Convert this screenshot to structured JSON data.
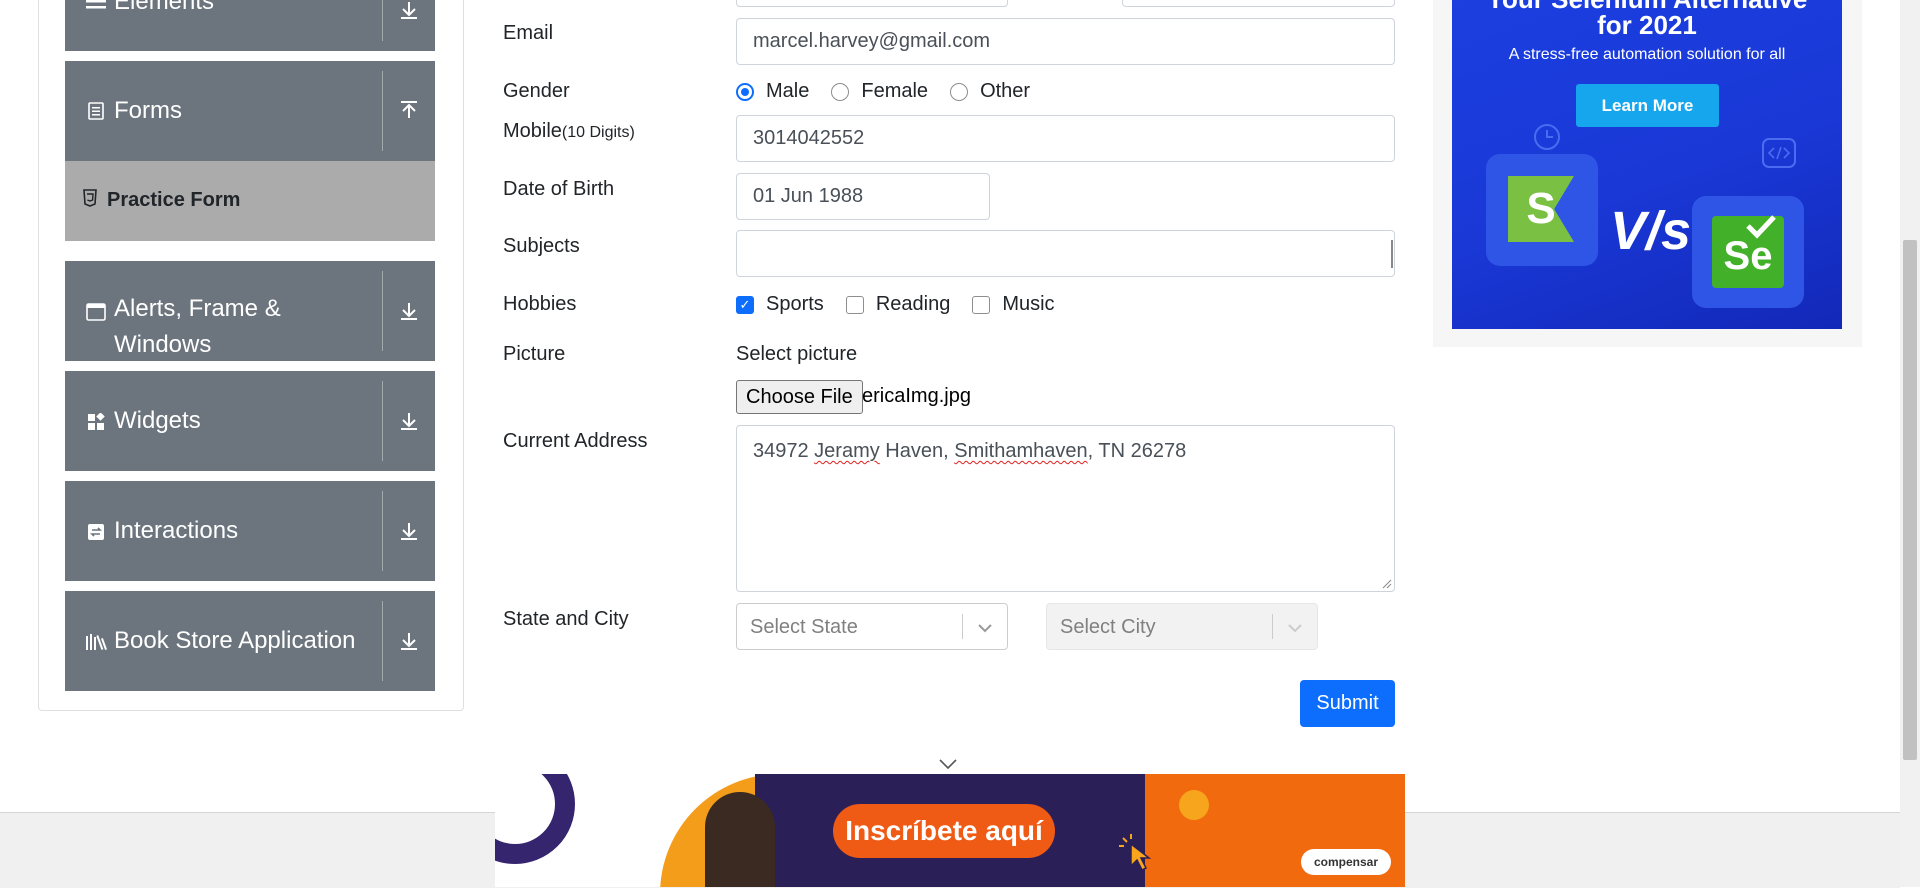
{
  "sidebar": {
    "groups": [
      {
        "label": "Elements"
      },
      {
        "label": "Forms"
      },
      {
        "label": "Alerts, Frame & Windows"
      },
      {
        "label": "Widgets"
      },
      {
        "label": "Interactions"
      },
      {
        "label": "Book Store Application"
      }
    ],
    "active_item": "Practice Form"
  },
  "form": {
    "email": {
      "label": "Email",
      "value": "marcel.harvey@gmail.com"
    },
    "gender": {
      "label": "Gender",
      "options": [
        "Male",
        "Female",
        "Other"
      ],
      "selected": "Male"
    },
    "mobile": {
      "label": "Mobile",
      "hint": "(10 Digits)",
      "value": "3014042552"
    },
    "dob": {
      "label": "Date of Birth",
      "value": "01 Jun 1988"
    },
    "subjects": {
      "label": "Subjects",
      "value": ""
    },
    "hobbies": {
      "label": "Hobbies",
      "options": [
        "Sports",
        "Reading",
        "Music"
      ],
      "checked": [
        "Sports"
      ]
    },
    "picture": {
      "label": "Picture",
      "select_text": "Select picture",
      "button": "Choose File",
      "file": "ericaImg.jpg"
    },
    "address": {
      "label": "Current Address",
      "value_parts": [
        "34972 ",
        "Jeramy",
        " Haven, ",
        "Smithamhaven",
        ", TN 26278"
      ]
    },
    "state_city": {
      "label": "State and City",
      "state_placeholder": "Select State",
      "city_placeholder": "Select City"
    },
    "submit": "Submit"
  },
  "ads": {
    "right": {
      "headline1": "Your Selenium Alternative",
      "headline2": "for 2021",
      "tagline": "A stress-free automation solution for all",
      "cta": "Learn More",
      "vs": "V/s",
      "left_logo": "S",
      "right_logo": "Se"
    },
    "bottom": {
      "cta": "Inscríbete aquí",
      "brand": "compensar"
    }
  },
  "colors": {
    "sidebar_group": "#6c757d",
    "active_item": "#ababab",
    "primary": "#0d6efd",
    "ad_blue": "#1c3fe0",
    "ad_orange": "#ef5a14"
  }
}
